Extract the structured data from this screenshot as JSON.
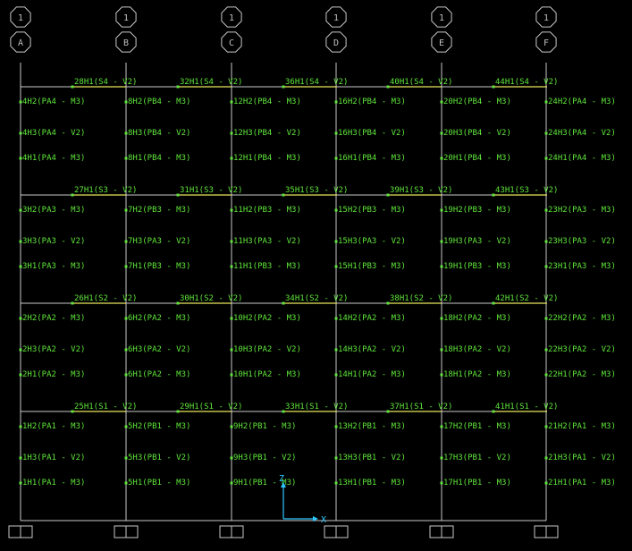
{
  "colors": {
    "background": "#000000",
    "frame": "#c9c9c9",
    "label": "#5fe63a",
    "beam": "#e6e65c",
    "hinge": "#5fe63a",
    "ucs": "#2ec7ff"
  },
  "grid_bubbles": [
    {
      "top": "1",
      "bottom": "A"
    },
    {
      "top": "1",
      "bottom": "B"
    },
    {
      "top": "1",
      "bottom": "C"
    },
    {
      "top": "1",
      "bottom": "D"
    },
    {
      "top": "1",
      "bottom": "E"
    },
    {
      "top": "1",
      "bottom": "F"
    }
  ],
  "beam_labels": [
    [
      "28H1(S4 - V2)",
      "32H1(S4 - V2)",
      "36H1(S4 - V2)",
      "40H1(S4 - V2)",
      "44H1(S4 - V2)"
    ],
    [
      "27H1(S3 - V2)",
      "31H1(S3 - V2)",
      "35H1(S3 - V2)",
      "39H1(S3 - V2)",
      "43H1(S3 - V2)"
    ],
    [
      "26H1(S2 - V2)",
      "30H1(S2 - V2)",
      "34H1(S2 - V2)",
      "38H1(S2 - V2)",
      "42H1(S2 - V2)"
    ],
    [
      "25H1(S1 - V2)",
      "29H1(S1 - V2)",
      "33H1(S1 - V2)",
      "37H1(S1 - V2)",
      "41H1(S1 - V2)"
    ]
  ],
  "column_labels": [
    [
      [
        "4H2(PA4 - M3)",
        "4H3(PA4 - V2)",
        "4H1(PA4 - M3)"
      ],
      [
        "3H2(PA3 - M3)",
        "3H3(PA3 - V2)",
        "3H1(PA3 - M3)"
      ],
      [
        "2H2(PA2 - M3)",
        "2H3(PA2 - V2)",
        "2H1(PA2 - M3)"
      ],
      [
        "1H2(PA1 - M3)",
        "1H3(PA1 - V2)",
        "1H1(PA1 - M3)"
      ]
    ],
    [
      [
        "8H2(PB4 - M3)",
        "8H3(PB4 - V2)",
        "8H1(PB4 - M3)"
      ],
      [
        "7H2(PB3 - M3)",
        "7H3(PA3 - V2)",
        "7H1(PB3 - M3)"
      ],
      [
        "6H2(PA2 - M3)",
        "6H3(PA2 - V2)",
        "6H1(PA2 - M3)"
      ],
      [
        "5H2(PB1 - M3)",
        "5H3(PB1 - V2)",
        "5H1(PB1 - M3)"
      ]
    ],
    [
      [
        "12H2(PB4 - M3)",
        "12H3(PB4 - V2)",
        "12H1(PB4 - M3)"
      ],
      [
        "11H2(PB3 - M3)",
        "11H3(PA3 - V2)",
        "11H1(PB3 - M3)"
      ],
      [
        "10H2(PA2 - M3)",
        "10H3(PA2 - V2)",
        "10H1(PA2 - M3)"
      ],
      [
        "9H2(PB1 - M3)",
        "9H3(PB1 - V2)",
        "9H1(PB1 - M3)"
      ]
    ],
    [
      [
        "16H2(PB4 - M3)",
        "16H3(PB4 - V2)",
        "16H1(PB4 - M3)"
      ],
      [
        "15H2(PB3 - M3)",
        "15H3(PA3 - V2)",
        "15H1(PB3 - M3)"
      ],
      [
        "14H2(PA2 - M3)",
        "14H3(PA2 - V2)",
        "14H1(PA2 - M3)"
      ],
      [
        "13H2(PB1 - M3)",
        "13H3(PB1 - V2)",
        "13H1(PB1 - M3)"
      ]
    ],
    [
      [
        "20H2(PB4 - M3)",
        "20H3(PB4 - V2)",
        "20H1(PB4 - M3)"
      ],
      [
        "19H2(PB3 - M3)",
        "19H3(PA3 - V2)",
        "19H1(PB3 - M3)"
      ],
      [
        "18H2(PA2 - M3)",
        "18H3(PA2 - V2)",
        "18H1(PA2 - M3)"
      ],
      [
        "17H2(PB1 - M3)",
        "17H3(PB1 - V2)",
        "17H1(PB1 - M3)"
      ]
    ],
    [
      [
        "24H2(PA4 - M3)",
        "24H3(PA4 - V2)",
        "24H1(PA4 - M3)"
      ],
      [
        "23H2(PA3 - M3)",
        "23H3(PA3 - V2)",
        "23H1(PA3 - M3)"
      ],
      [
        "22H2(PA2 - M3)",
        "22H3(PA2 - V2)",
        "22H1(PA2 - M3)"
      ],
      [
        "21H2(PA1 - M3)",
        "21H3(PA1 - V2)",
        "21H1(PA1 - M3)"
      ]
    ]
  ],
  "ucs": {
    "x_label": "X",
    "y_label": "Z"
  }
}
